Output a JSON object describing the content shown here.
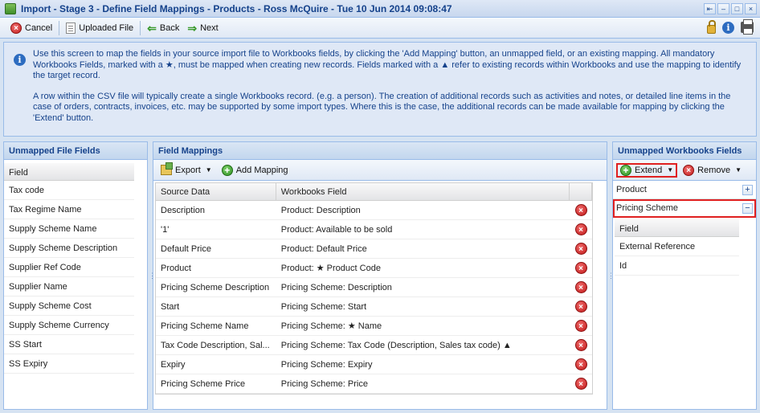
{
  "window": {
    "title": "Import - Stage 3 - Define Field Mappings - Products - Ross McQuire - Tue 10 Jun 2014 09:08:47"
  },
  "toolbar": {
    "cancel": "Cancel",
    "uploaded_file": "Uploaded File",
    "back": "Back",
    "next": "Next"
  },
  "info": {
    "para1": "Use this screen to map the fields in your source import file to Workbooks fields, by clicking the 'Add Mapping' button, an unmapped field, or an existing mapping. All mandatory Workbooks Fields, marked with a ★, must be mapped when creating new records. Fields marked with a ▲ refer to existing records within Workbooks and use the mapping to identify the target record.",
    "para2": "A row within the CSV file will typically create a single Workbooks record. (e.g. a person). The creation of additional records such as activities and notes, or detailed line items in the case of orders, contracts, invoices, etc. may be supported by some import types. Where this is the case, the additional records can be made available for mapping by clicking the 'Extend' button."
  },
  "unmapped_file": {
    "title": "Unmapped File Fields",
    "column": "Field",
    "rows": [
      "Tax code",
      "Tax Regime Name",
      "Supply Scheme Name",
      "Supply Scheme Description",
      "Supplier Ref Code",
      "Supplier Name",
      "Supply Scheme Cost",
      "Supply Scheme Currency",
      "SS Start",
      "SS Expiry"
    ]
  },
  "mappings": {
    "title": "Field Mappings",
    "export": "Export",
    "add_mapping": "Add Mapping",
    "col_source": "Source Data",
    "col_target": "Workbooks Field",
    "rows": [
      {
        "source": "Description",
        "target": "Product: Description"
      },
      {
        "source": "'1'",
        "target": "Product: Available to be sold"
      },
      {
        "source": "Default Price",
        "target": "Product: Default Price"
      },
      {
        "source": "Product",
        "target": "Product: ★ Product Code"
      },
      {
        "source": "Pricing Scheme Description",
        "target": "Pricing Scheme: Description"
      },
      {
        "source": "Start",
        "target": "Pricing Scheme: Start"
      },
      {
        "source": "Pricing Scheme Name",
        "target": "Pricing Scheme: ★ Name"
      },
      {
        "source": "Tax Code Description, Sal...",
        "target": "Pricing Scheme: Tax Code (Description, Sales tax code) ▲"
      },
      {
        "source": "Expiry",
        "target": "Pricing Scheme: Expiry"
      },
      {
        "source": "Pricing Scheme Price",
        "target": "Pricing Scheme: Price"
      }
    ]
  },
  "unmapped_workbooks": {
    "title": "Unmapped Workbooks Fields",
    "extend": "Extend",
    "remove": "Remove",
    "group_product": "Product",
    "group_pricing": "Pricing Scheme",
    "column": "Field",
    "rows": [
      "External Reference",
      "Id"
    ]
  }
}
